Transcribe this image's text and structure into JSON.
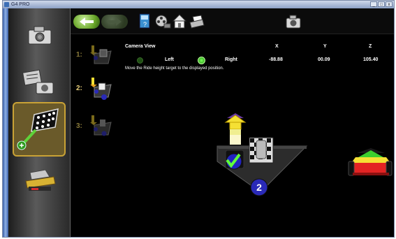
{
  "window": {
    "title": "G4 PRO",
    "buttons": [
      "_",
      "□",
      "x"
    ]
  },
  "sidebar": {
    "items": [
      {
        "name": "camera-setup",
        "icon": "camera-icon"
      },
      {
        "name": "calibration",
        "icon": "camera-calibration-icon"
      },
      {
        "name": "ride-height-target",
        "icon": "ride-height-target-icon",
        "active": true
      },
      {
        "name": "vehicle-alignment",
        "icon": "vehicle-lift-icon"
      }
    ]
  },
  "toolbar": {
    "icons": [
      "back-arrow-icon",
      "forward-arrow-icon",
      "help-book-icon",
      "video-reel-icon",
      "home-icon",
      "print-icon",
      "camera-view-icon"
    ]
  },
  "steps": [
    {
      "label": "1:"
    },
    {
      "label": "2:"
    },
    {
      "label": "3:"
    }
  ],
  "header": {
    "camera_view": "Camera View",
    "left": "Left",
    "right": "Right",
    "x_label": "X",
    "y_label": "Y",
    "z_label": "Z",
    "x_value": "-88.88",
    "y_value": "00.09",
    "z_value": "105.40",
    "selected_camera": "Right"
  },
  "instruction": "Move the Ride height target to the displayed position.",
  "scene": {
    "step_badge": "2",
    "colors": {
      "yellow": "#f5e034",
      "red": "#e32323",
      "green": "#3ccf2e",
      "badge_blue": "#2a2ab8",
      "gold_border": "#c9a235"
    }
  }
}
